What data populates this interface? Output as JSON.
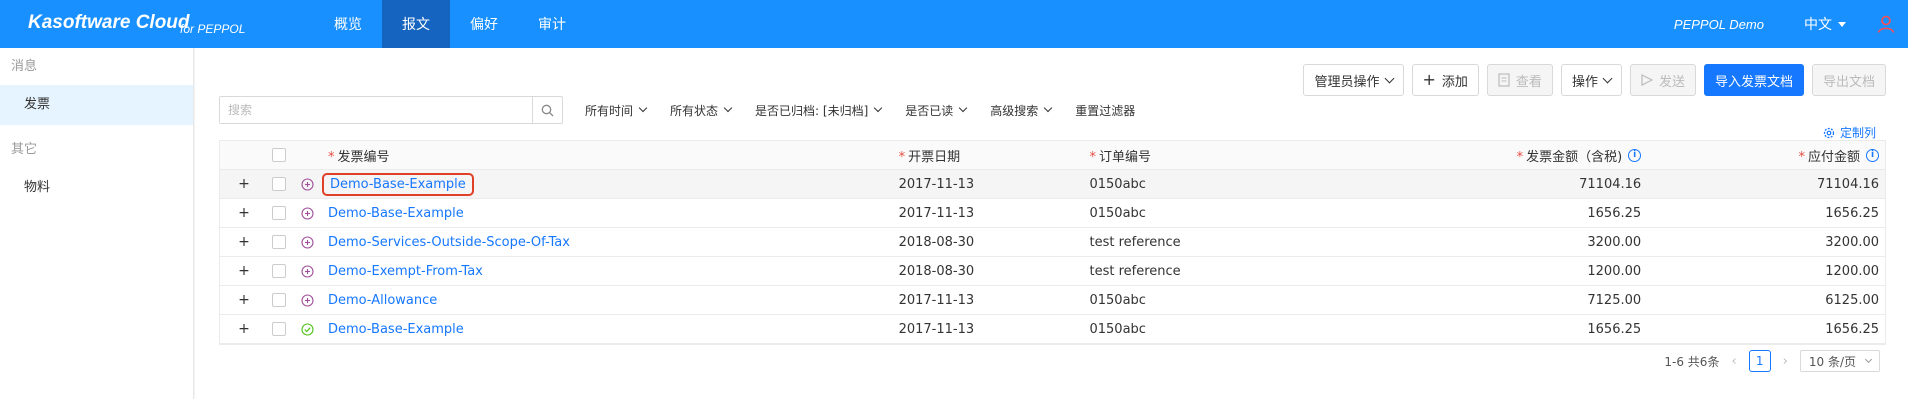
{
  "header": {
    "brand_title": "Kasoftware Cloud",
    "brand_sub": "for PEPPOL",
    "nav": [
      "概览",
      "报文",
      "偏好",
      "审计"
    ],
    "active_nav": "报文",
    "org": "PEPPOL Demo",
    "language": "中文",
    "user_icon": "user-icon"
  },
  "sidebar": {
    "group1": "消息",
    "item1": "发票",
    "group2": "其它",
    "item2": "物料"
  },
  "toolbar": {
    "admin_ops": "管理员操作",
    "add": "添加",
    "view": "查看",
    "ops": "操作",
    "send": "发送",
    "import": "导入发票文档",
    "export": "导出文档"
  },
  "search": {
    "placeholder": "搜索"
  },
  "filters": {
    "time": "所有时间",
    "status": "所有状态",
    "archived": "是否已归档: [未归档]",
    "read": "是否已读",
    "advanced": "高级搜索",
    "reset": "重置过滤器"
  },
  "customize_label": "定制列",
  "table": {
    "columns": {
      "invoice_no": "发票编号",
      "issue_date": "开票日期",
      "order_no": "订单编号",
      "amount": "发票金额（含税)",
      "payable": "应付金额"
    },
    "rows": [
      {
        "expand": "+",
        "status_icon": "plus-circle-icon",
        "invoice": "Demo-Base-Example",
        "date": "2017-11-13",
        "order": "0150abc",
        "amount": "71104.16",
        "payable": "71104.16"
      },
      {
        "expand": "+",
        "status_icon": "plus-circle-icon",
        "invoice": "Demo-Base-Example",
        "date": "2017-11-13",
        "order": "0150abc",
        "amount": "1656.25",
        "payable": "1656.25"
      },
      {
        "expand": "+",
        "status_icon": "plus-circle-icon",
        "invoice": "Demo-Services-Outside-Scope-Of-Tax",
        "date": "2018-08-30",
        "order": "test reference",
        "amount": "3200.00",
        "payable": "3200.00"
      },
      {
        "expand": "+",
        "status_icon": "plus-circle-icon",
        "invoice": "Demo-Exempt-From-Tax",
        "date": "2018-08-30",
        "order": "test reference",
        "amount": "1200.00",
        "payable": "1200.00"
      },
      {
        "expand": "+",
        "status_icon": "plus-circle-icon",
        "invoice": "Demo-Allowance",
        "date": "2017-11-13",
        "order": "0150abc",
        "amount": "7125.00",
        "payable": "6125.00"
      },
      {
        "expand": "+",
        "status_icon": "check-circle-icon",
        "invoice": "Demo-Base-Example",
        "date": "2017-11-13",
        "order": "0150abc",
        "amount": "1656.25",
        "payable": "1656.25"
      }
    ]
  },
  "pagination": {
    "summary": "1-6 共6条",
    "current_page": "1",
    "page_size": "10 条/页"
  },
  "colors": {
    "topbar": "#1890ff",
    "active_nav": "#1565c0",
    "link": "#1677ff",
    "highlight": "#e04027",
    "pending_icon": "#a0509a",
    "done_icon": "#52c41a"
  }
}
